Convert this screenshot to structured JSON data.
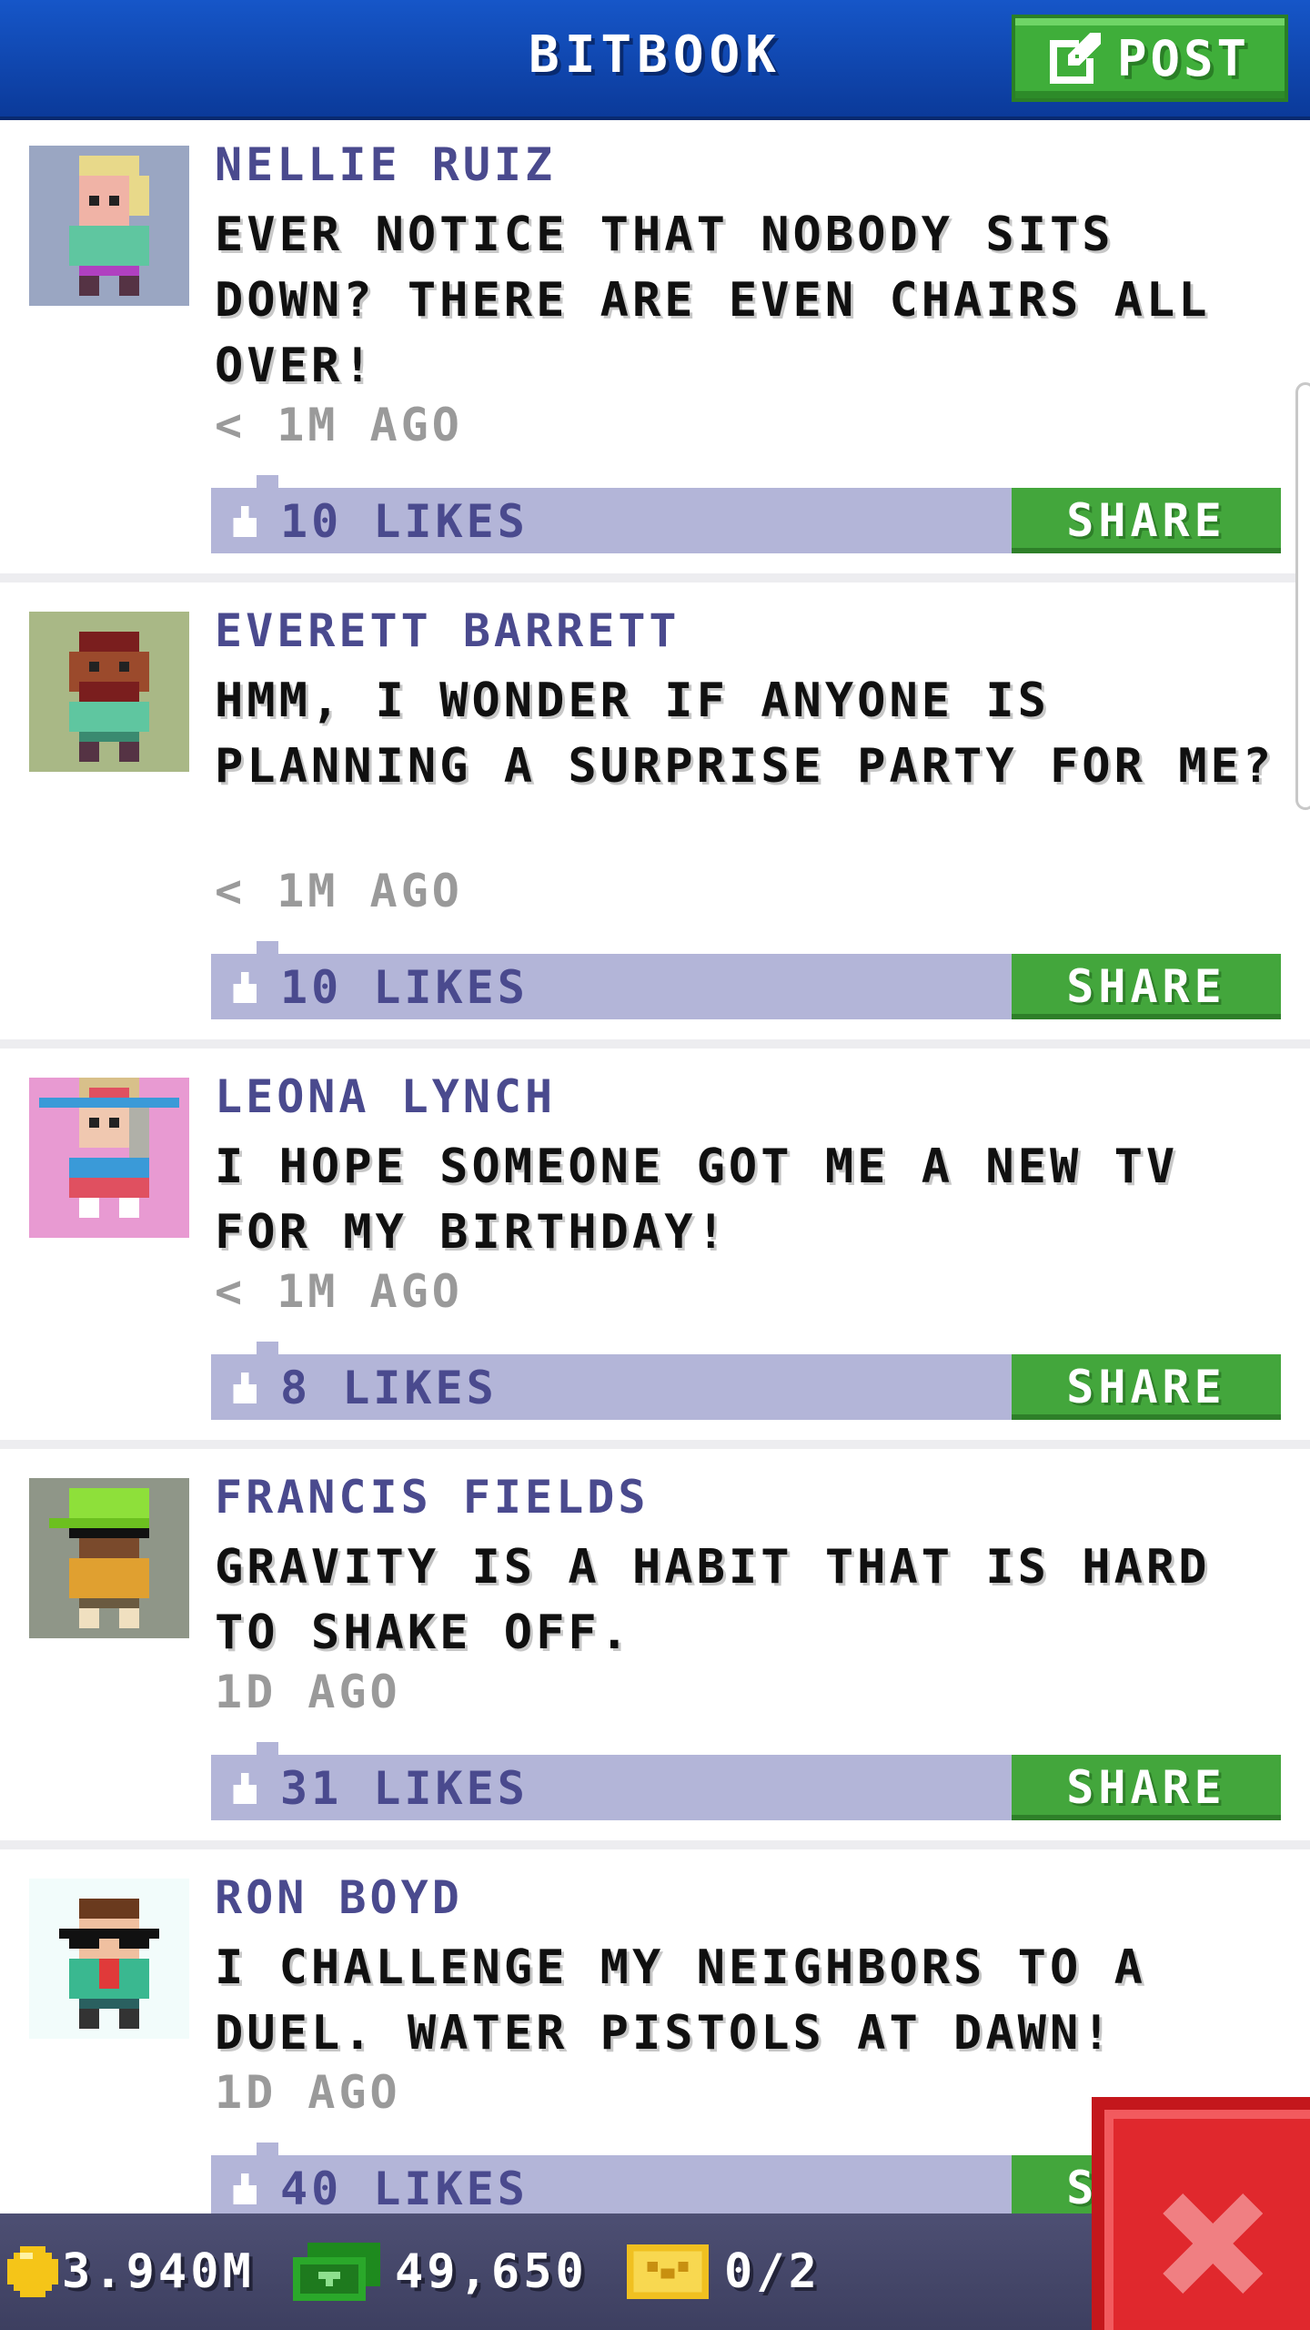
{
  "header": {
    "title": "BITBOOK",
    "post_label": "POST"
  },
  "posts": [
    {
      "author": "NELLIE RUIZ",
      "message": "EVER NOTICE THAT NOBODY SITS DOWN? THERE ARE EVEN CHAIRS ALL OVER!",
      "time": "< 1M AGO",
      "likes_label": "10 LIKES",
      "share_label": "SHARE",
      "avatar_bg": "#9aa6c2"
    },
    {
      "author": "EVERETT BARRETT",
      "message": "HMM, I WONDER IF ANYONE IS PLANNING A SURPRISE PARTY FOR ME?",
      "time": "< 1M AGO",
      "likes_label": "10 LIKES",
      "share_label": "SHARE",
      "avatar_bg": "#a9b886"
    },
    {
      "author": "LEONA LYNCH",
      "message": "I HOPE SOMEONE GOT ME A NEW TV FOR MY BIRTHDAY!",
      "time": "< 1M AGO",
      "likes_label": "8 LIKES",
      "share_label": "SHARE",
      "avatar_bg": "#e89ad2"
    },
    {
      "author": "FRANCIS FIELDS",
      "message": "GRAVITY IS A HABIT THAT IS HARD TO SHAKE OFF.",
      "time": "1D AGO",
      "likes_label": "31 LIKES",
      "share_label": "SHARE",
      "avatar_bg": "#8f9688"
    },
    {
      "author": "RON BOYD",
      "message": "I CHALLENGE MY NEIGHBORS TO A DUEL. WATER PISTOLS AT DAWN!",
      "time": "1D AGO",
      "likes_label": "40 LIKES",
      "share_label": "SHARE",
      "avatar_bg": "#f2fcfb"
    }
  ],
  "bottom_bar": {
    "coins": "3.940M",
    "bux": "49,650",
    "tickets": "0/2"
  },
  "icons": {
    "post": "edit-icon",
    "like": "thumbs-up-icon",
    "coin": "coin-icon",
    "bux": "cash-icon",
    "ticket": "ticket-icon",
    "close": "close-icon"
  },
  "colors": {
    "header": "#1656c8",
    "post_button": "#3fae3a",
    "share_button": "#43a63c",
    "likes_bar": "#b3b5d8",
    "author_text": "#4a4a8e",
    "bottom_bar": "#4d4f73",
    "close_button": "#e0282d"
  }
}
